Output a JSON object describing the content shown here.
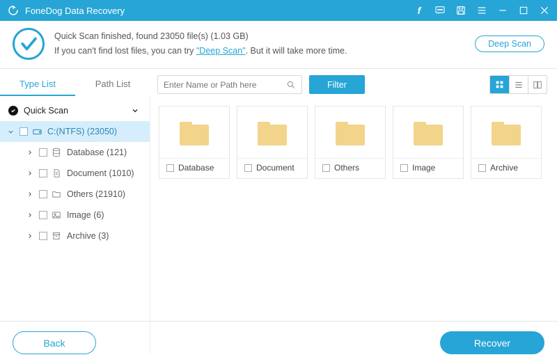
{
  "titlebar": {
    "app_name": "FoneDog Data Recovery"
  },
  "summary": {
    "line1": "Quick Scan finished, found 23050 file(s) (1.03 GB)",
    "line2_prefix": "If you can't find lost files, you can try ",
    "deep_scan_link": "\"Deep Scan\"",
    "line2_suffix": ". But it will take more time.",
    "deep_scan_btn": "Deep Scan"
  },
  "tabs": {
    "type_list": "Type List",
    "path_list": "Path List"
  },
  "search": {
    "placeholder": "Enter Name or Path here"
  },
  "filter_btn": "Filter",
  "tree": {
    "root": "Quick Scan",
    "drive": "C:(NTFS) (23050)",
    "children": [
      {
        "label": "Database (121)"
      },
      {
        "label": "Document (1010)"
      },
      {
        "label": "Others (21910)"
      },
      {
        "label": "Image (6)"
      },
      {
        "label": "Archive (3)"
      }
    ]
  },
  "cards": [
    {
      "label": "Database"
    },
    {
      "label": "Document"
    },
    {
      "label": "Others"
    },
    {
      "label": "Image"
    },
    {
      "label": "Archive"
    }
  ],
  "footer": {
    "back": "Back",
    "recover": "Recover"
  }
}
